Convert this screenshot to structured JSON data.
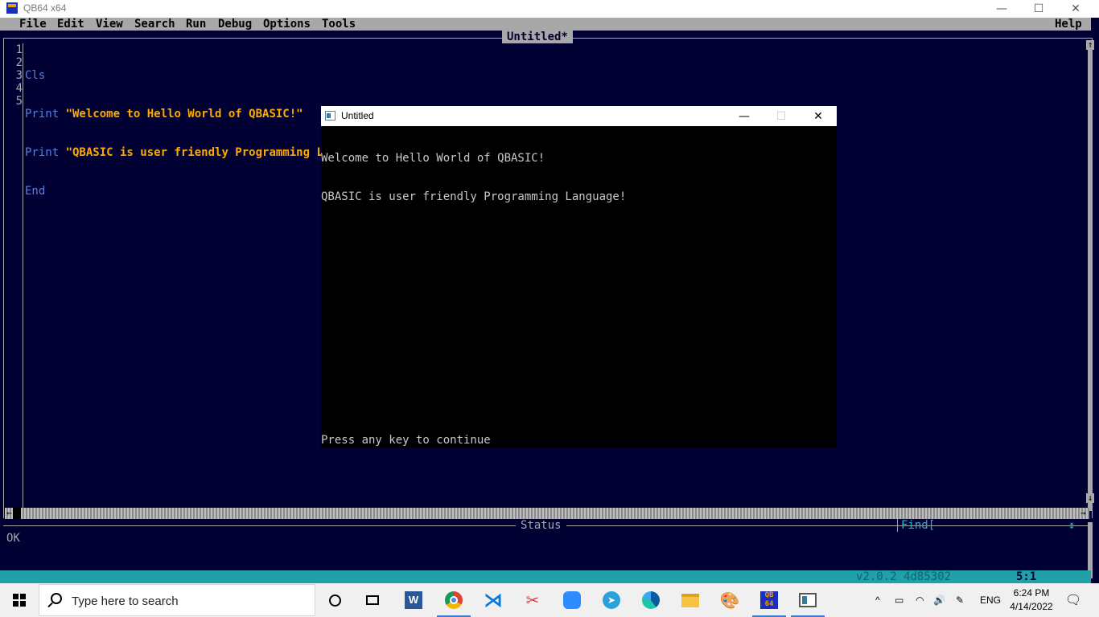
{
  "window": {
    "title": "QB64 x64",
    "min": "—",
    "max": "☐",
    "close": "✕"
  },
  "menu": {
    "file": "File",
    "edit": "Edit",
    "view": "View",
    "search": "Search",
    "run": "Run",
    "debug": "Debug",
    "options": "Options",
    "tools": "Tools",
    "help": "Help"
  },
  "editor": {
    "tab_title": "Untitled*",
    "line_numbers": [
      "1",
      "2",
      "3",
      "4",
      "5"
    ],
    "lines": [
      {
        "keyword": "Cls",
        "string": ""
      },
      {
        "keyword": "Print ",
        "string": "\"Welcome to Hello World of QBASIC!\""
      },
      {
        "keyword": "Print ",
        "string": "\"QBASIC is user friendly Programming Language!\""
      },
      {
        "keyword": "End",
        "string": ""
      },
      {
        "keyword": "",
        "string": ""
      }
    ]
  },
  "status": {
    "label": "Status",
    "text": "OK",
    "find_label": "Find[",
    "find_arrow": "↕"
  },
  "bottombar": {
    "version": "v2.0.2 4d85302",
    "position": "5:1"
  },
  "output_window": {
    "title": "Untitled",
    "line1": "Welcome to Hello World of QBASIC!",
    "line2": "QBASIC is user friendly Programming Language!",
    "prompt": "Press any key to continue"
  },
  "taskbar": {
    "search_placeholder": "Type here to search",
    "icons": [
      "cortana-icon",
      "task-view-icon",
      "word-icon",
      "chrome-icon",
      "vscode-icon",
      "snipping-icon",
      "zoom-icon",
      "telegram-icon",
      "edge-icon",
      "file-explorer-icon",
      "paint-icon",
      "qb64-icon",
      "output-window-icon"
    ],
    "language": "ENG",
    "time": "6:24 PM",
    "date": "4/14/2022"
  },
  "colors": {
    "ide_bg": "#000033",
    "keyword": "#5b7fdb",
    "string": "#ffaa00",
    "bottombar": "#20a0a8"
  }
}
